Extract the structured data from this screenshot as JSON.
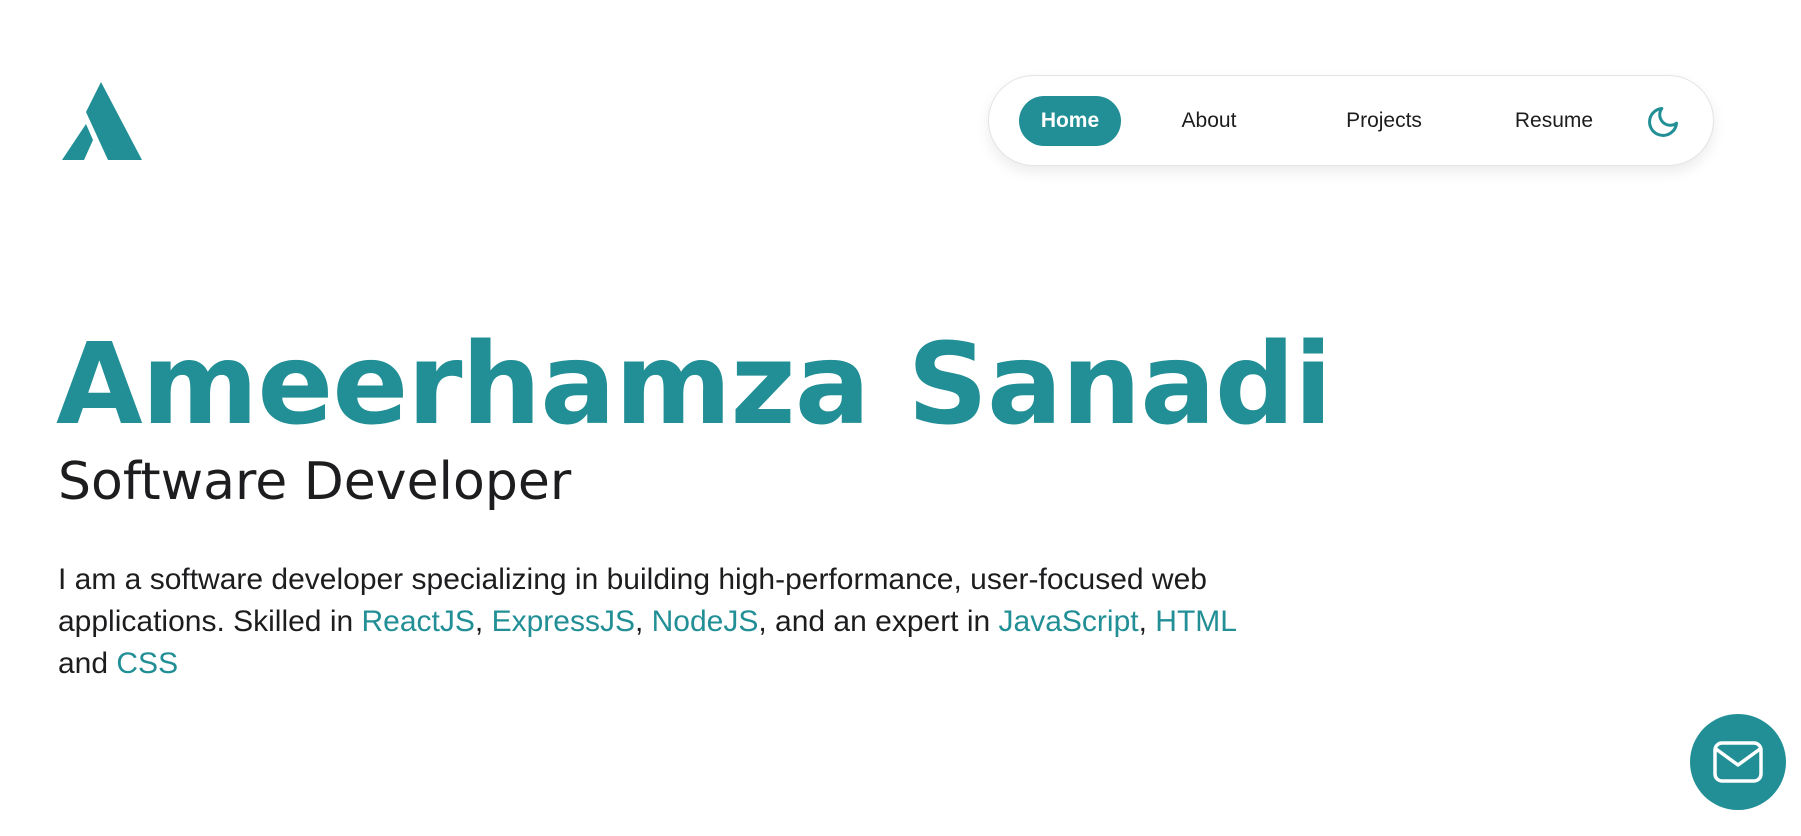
{
  "colors": {
    "accent": "#218f95",
    "text": "#1d1d1f",
    "background": "#ffffff"
  },
  "logo": {
    "icon": "a-letter-logo-icon"
  },
  "nav": {
    "items": [
      {
        "label": "Home",
        "active": true
      },
      {
        "label": "About",
        "active": false
      },
      {
        "label": "Projects",
        "active": false
      },
      {
        "label": "Resume",
        "active": false
      }
    ],
    "theme_toggle_icon": "moon-icon"
  },
  "hero": {
    "name": "Ameerhamza Sanadi",
    "role": "Software Developer",
    "intro": {
      "prefix": "I am a software developer specializing in building high-performance, user-focused web applications. Skilled in ",
      "tech1": "ReactJS",
      "sep1": ", ",
      "tech2": "ExpressJS",
      "sep2": ", ",
      "tech3": "NodeJS",
      "mid": ", and an expert in ",
      "tech4": "JavaScript",
      "sep3": ", ",
      "tech5": "HTML",
      "and": " and ",
      "tech6": "CSS"
    }
  },
  "contact": {
    "icon": "mail-icon"
  }
}
